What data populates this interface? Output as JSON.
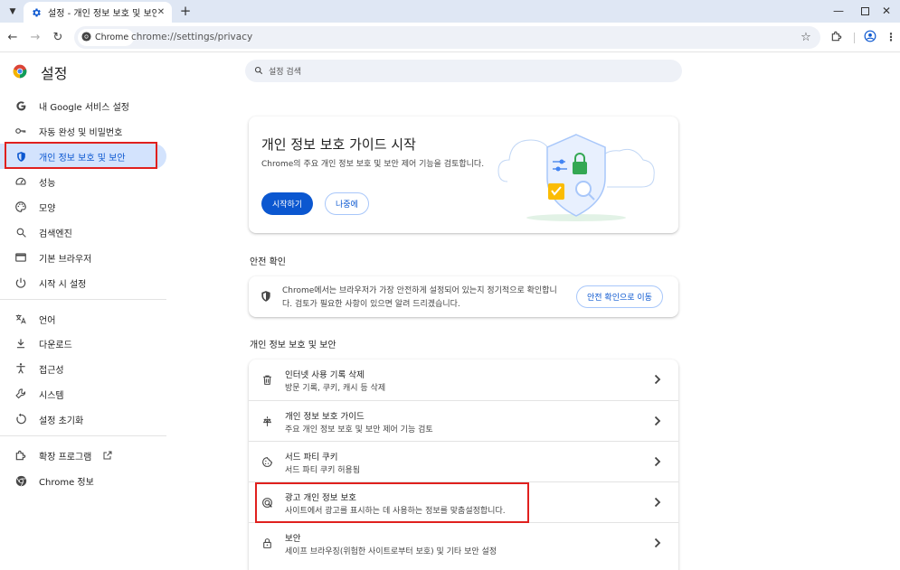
{
  "tab": {
    "title": "설정 - 개인 정보 보호 및 보안"
  },
  "omnibox": {
    "chip_label": "Chrome",
    "url": "chrome://settings/privacy"
  },
  "sidebar": {
    "title": "설정",
    "items": [
      {
        "label": "내 Google 서비스 설정",
        "icon": "google-g-icon"
      },
      {
        "label": "자동 완성 및 비밀번호",
        "icon": "key-icon"
      },
      {
        "label": "개인 정보 보호 및 보안",
        "icon": "shield-icon",
        "active": true
      },
      {
        "label": "성능",
        "icon": "speedometer-icon"
      },
      {
        "label": "모양",
        "icon": "palette-icon"
      },
      {
        "label": "검색엔진",
        "icon": "search-icon"
      },
      {
        "label": "기본 브라우저",
        "icon": "browser-window-icon"
      },
      {
        "label": "시작 시 설정",
        "icon": "power-icon"
      },
      {
        "label": "언어",
        "icon": "translate-icon"
      },
      {
        "label": "다운로드",
        "icon": "download-icon"
      },
      {
        "label": "접근성",
        "icon": "accessibility-icon"
      },
      {
        "label": "시스템",
        "icon": "wrench-icon"
      },
      {
        "label": "설정 초기화",
        "icon": "reset-icon"
      },
      {
        "label": "확장 프로그램",
        "icon": "puzzle-icon"
      },
      {
        "label": "Chrome 정보",
        "icon": "chrome-logo-icon"
      }
    ]
  },
  "search": {
    "placeholder": "설정 검색"
  },
  "guide_card": {
    "title": "개인 정보 보호 가이드 시작",
    "description": "Chrome의 주요 개인 정보 보호 및 보안 제어 기능을 검토합니다.",
    "start_button": "시작하기",
    "later_button": "나중에"
  },
  "safety": {
    "heading": "안전 확인",
    "text": "Chrome에서는 브라우저가 가장 안전하게 설정되어 있는지 정기적으로 확인합니다. 검토가 필요한 사항이 있으면 알려 드리겠습니다.",
    "button": "안전 확인으로 이동"
  },
  "privacy": {
    "heading": "개인 정보 보호 및 보안",
    "rows": [
      {
        "title": "인터넷 사용 기록 삭제",
        "sub": "방문 기록, 쿠키, 캐시 등 삭제",
        "icon": "trash-icon"
      },
      {
        "title": "개인 정보 보호 가이드",
        "sub": "주요 개인 정보 보호 및 보안 제어 기능 검토",
        "icon": "guide-icon"
      },
      {
        "title": "서드 파티 쿠키",
        "sub": "서드 파티 쿠키 허용됨",
        "icon": "cookie-icon"
      },
      {
        "title": "광고 개인 정보 보호",
        "sub": "사이트에서 광고를 표시하는 데 사용하는 정보를 맞춤설정합니다.",
        "icon": "ad-privacy-icon"
      },
      {
        "title": "보안",
        "sub": "세이프 브라우징(위험한 사이트로부터 보호) 및 기타 보안 설정",
        "icon": "lock-icon"
      }
    ]
  },
  "colors": {
    "accent": "#0b57d0",
    "active_bg": "#d3e3fd",
    "highlight": "#e0201e"
  }
}
